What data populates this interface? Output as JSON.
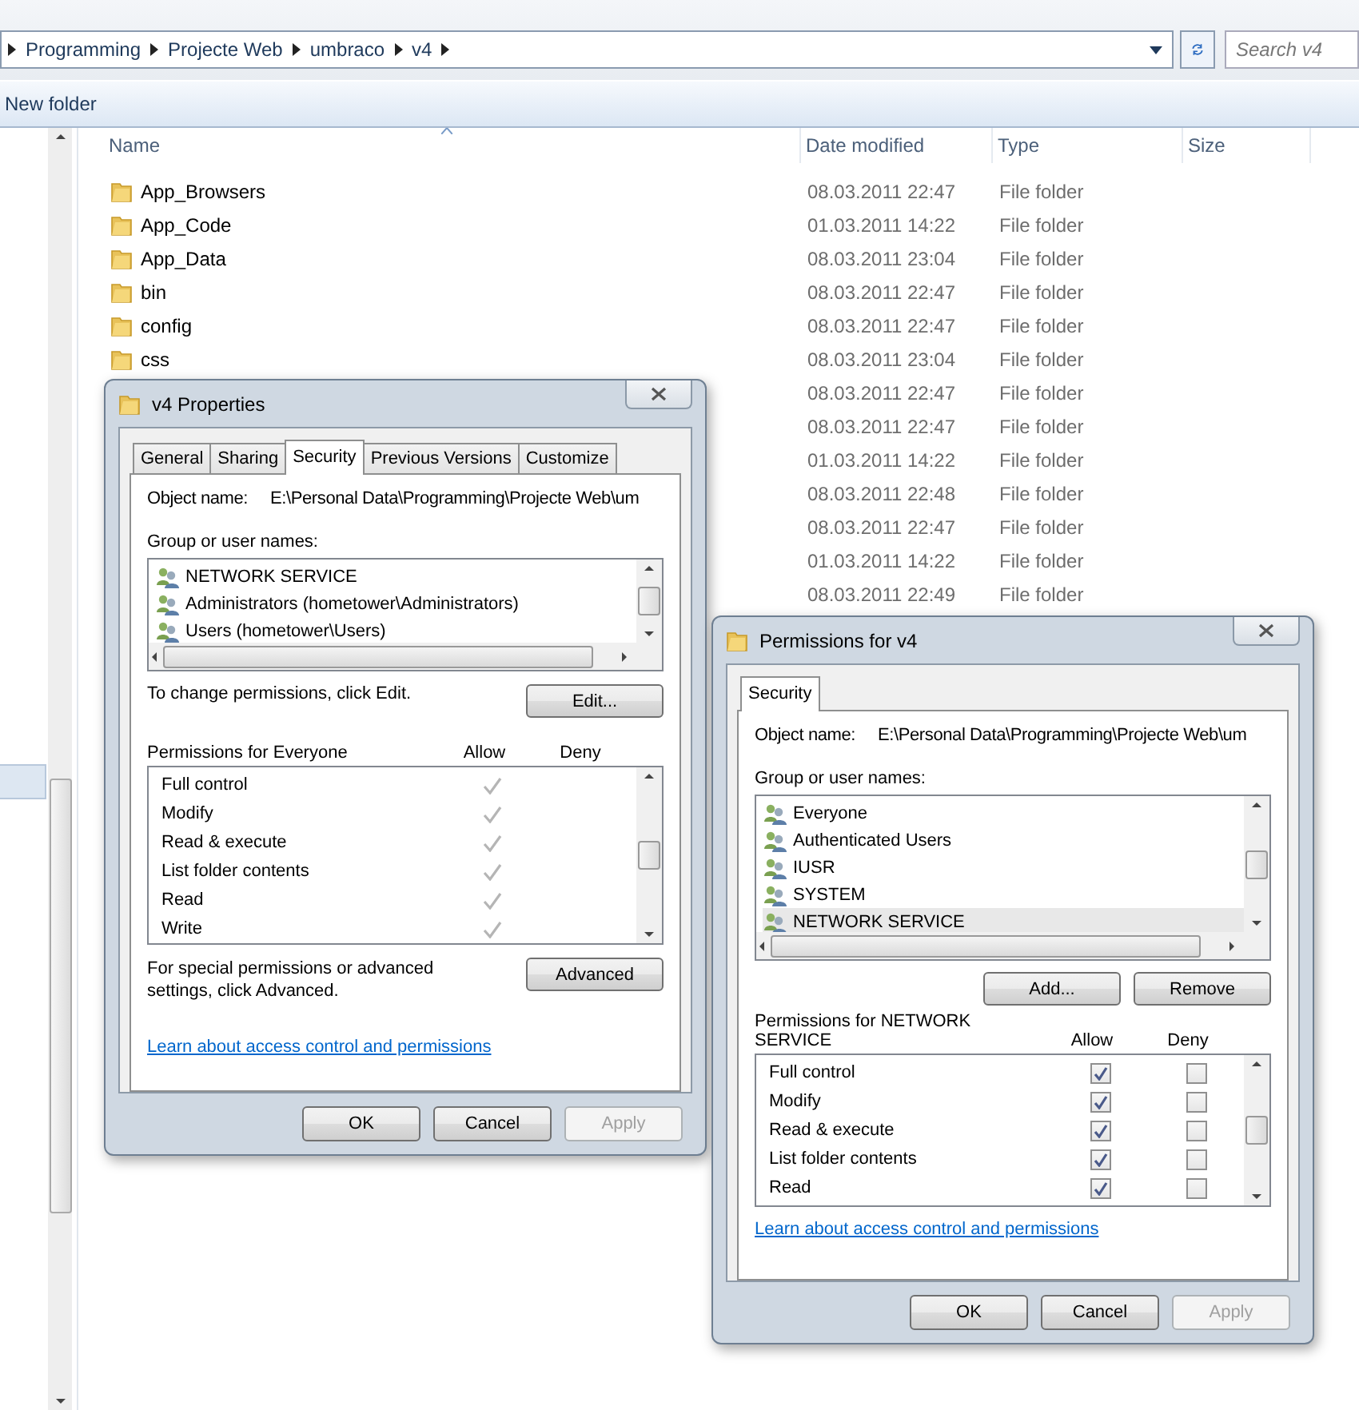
{
  "explorer": {
    "breadcrumb": [
      "Programming",
      "Projecte Web",
      "umbraco",
      "v4"
    ],
    "search": {
      "placeholder": "Search v4"
    },
    "toolbar": [
      "New folder"
    ],
    "columns": [
      "Name",
      "Date modified",
      "Type",
      "Size"
    ],
    "rows": [
      {
        "name": "App_Browsers",
        "date": "08.03.2011 22:47",
        "type": "File folder"
      },
      {
        "name": "App_Code",
        "date": "01.03.2011 14:22",
        "type": "File folder"
      },
      {
        "name": "App_Data",
        "date": "08.03.2011 23:04",
        "type": "File folder"
      },
      {
        "name": "bin",
        "date": "08.03.2011 22:47",
        "type": "File folder"
      },
      {
        "name": "config",
        "date": "08.03.2011 22:47",
        "type": "File folder"
      },
      {
        "name": "css",
        "date": "08.03.2011 23:04",
        "type": "File folder"
      },
      {
        "date": "08.03.2011 22:47",
        "type": "File folder"
      },
      {
        "date": "08.03.2011 22:47",
        "type": "File folder"
      },
      {
        "date": "01.03.2011 14:22",
        "type": "File folder"
      },
      {
        "date": "08.03.2011 22:48",
        "type": "File folder"
      },
      {
        "date": "08.03.2011 22:47",
        "type": "File folder"
      },
      {
        "date": "01.03.2011 14:22",
        "type": "File folder"
      },
      {
        "date": "08.03.2011 22:49",
        "type": "File folder"
      }
    ]
  },
  "dialogs": [
    {
      "title": "v4 Properties",
      "tabs": [
        {
          "label": "General",
          "selected": false
        },
        {
          "label": "Sharing",
          "selected": false
        },
        {
          "label": "Security",
          "selected": true
        },
        {
          "label": "Previous Versions",
          "selected": false
        },
        {
          "label": "Customize",
          "selected": false
        }
      ],
      "object_label": "Object name:",
      "object_name": "E:\\Personal Data\\Programming\\Projecte Web\\um",
      "group_label": "Group or user names:",
      "groups": [
        {
          "name": "NETWORK SERVICE",
          "selected": false
        },
        {
          "name": "Administrators (hometower\\Administrators)",
          "selected": false
        },
        {
          "name": "Users (hometower\\Users)",
          "selected": false
        }
      ],
      "change_hint": "To change permissions, click Edit.",
      "group_buttons": [
        "Edit..."
      ],
      "permissions_label": "Permissions for Everyone",
      "allow_header": "Allow",
      "deny_header": "Deny",
      "permissions": [
        {
          "kind": "inherited",
          "name": "Full control",
          "allow": true,
          "deny": false
        },
        {
          "kind": "inherited",
          "name": "Modify",
          "allow": true,
          "deny": false
        },
        {
          "kind": "inherited",
          "name": "Read & execute",
          "allow": true,
          "deny": false
        },
        {
          "kind": "inherited",
          "name": "List folder contents",
          "allow": true,
          "deny": false
        },
        {
          "kind": "inherited",
          "name": "Read",
          "allow": true,
          "deny": false
        },
        {
          "kind": "inherited",
          "name": "Write",
          "allow": true,
          "deny": false
        }
      ],
      "advanced_hint": "For special permissions or advanced settings, click Advanced.",
      "advanced_button": "Advanced",
      "link": "Learn about access control and permissions",
      "buttons": [
        {
          "label": "OK",
          "disabled": false
        },
        {
          "label": "Cancel",
          "disabled": false
        },
        {
          "label": "Apply",
          "disabled": true
        }
      ]
    },
    {
      "title": "Permissions for v4",
      "tabs": [
        {
          "label": "Security",
          "selected": true
        }
      ],
      "object_label": "Object name:",
      "object_name": "E:\\Personal Data\\Programming\\Projecte Web\\um",
      "group_label": "Group or user names:",
      "groups": [
        {
          "name": "Everyone",
          "selected": false
        },
        {
          "name": "Authenticated Users",
          "selected": false
        },
        {
          "name": "IUSR",
          "selected": false
        },
        {
          "name": "SYSTEM",
          "selected": false
        },
        {
          "name": "NETWORK SERVICE",
          "selected": true
        }
      ],
      "group_buttons": [
        "Add...",
        "Remove"
      ],
      "permissions_label": "Permissions for NETWORK SERVICE",
      "allow_header": "Allow",
      "deny_header": "Deny",
      "permissions": [
        {
          "kind": "checkbox",
          "name": "Full control",
          "allow": true,
          "deny": false
        },
        {
          "kind": "checkbox",
          "name": "Modify",
          "allow": true,
          "deny": false
        },
        {
          "kind": "checkbox",
          "name": "Read & execute",
          "allow": true,
          "deny": false
        },
        {
          "kind": "checkbox",
          "name": "List folder contents",
          "allow": true,
          "deny": false
        },
        {
          "kind": "checkbox",
          "name": "Read",
          "allow": true,
          "deny": false
        }
      ],
      "link": "Learn about access control and permissions",
      "buttons": [
        {
          "label": "OK",
          "disabled": false
        },
        {
          "label": "Cancel",
          "disabled": false
        },
        {
          "label": "Apply",
          "disabled": true
        }
      ]
    }
  ]
}
